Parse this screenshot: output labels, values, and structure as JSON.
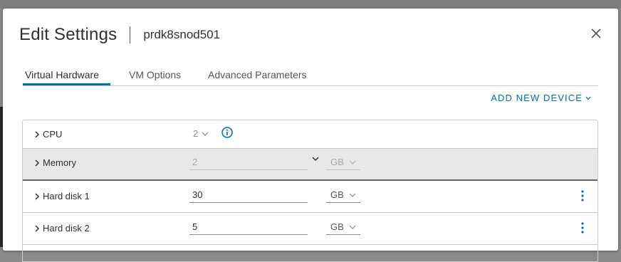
{
  "dialog": {
    "title": "Edit Settings",
    "vm_name": "prdk8snod501"
  },
  "tabs": [
    {
      "label": "Virtual Hardware",
      "active": true
    },
    {
      "label": "VM Options",
      "active": false
    },
    {
      "label": "Advanced Parameters",
      "active": false
    }
  ],
  "add_device_label": "ADD NEW DEVICE",
  "rows": {
    "cpu": {
      "label": "CPU",
      "value": "2"
    },
    "memory": {
      "label": "Memory",
      "value": "2",
      "unit": "GB"
    },
    "disk1": {
      "label": "Hard disk 1",
      "value": "30",
      "unit": "GB"
    },
    "disk2": {
      "label": "Hard disk 2",
      "value": "5",
      "unit": "GB"
    }
  },
  "colors": {
    "accent": "#0072a3",
    "text": "#313131",
    "expanded_row_bg": "#e8e8e8"
  },
  "icons": [
    "close-icon",
    "chevron-right-icon",
    "chevron-down-icon",
    "info-icon",
    "kebab-menu-icon"
  ]
}
